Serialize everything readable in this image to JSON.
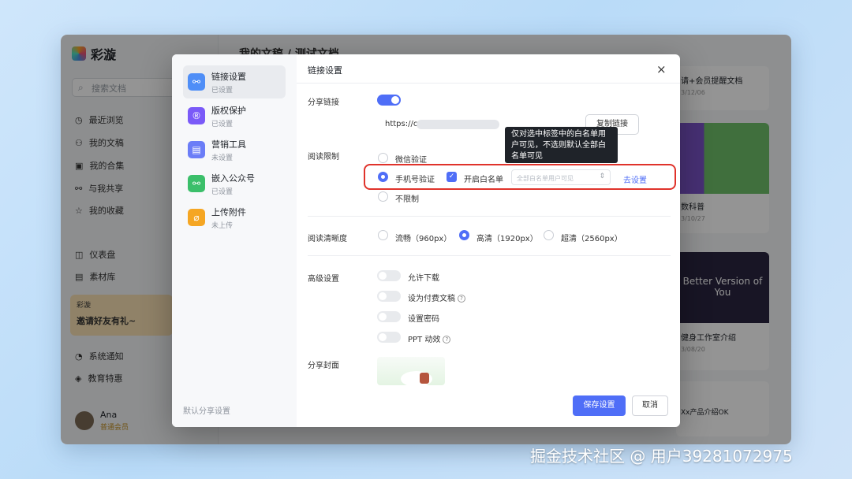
{
  "app": {
    "brand": "彩漩",
    "search_placeholder": "搜索文档",
    "nav": [
      {
        "icon": "clock-icon",
        "glyph": "◷",
        "label": "最近浏览"
      },
      {
        "icon": "user-icon",
        "glyph": "⚇",
        "label": "我的文稿"
      },
      {
        "icon": "collection-icon",
        "glyph": "▣",
        "label": "我的合集"
      },
      {
        "icon": "share-icon",
        "glyph": "⚯",
        "label": "与我共享"
      },
      {
        "icon": "star-icon",
        "glyph": "☆",
        "label": "我的收藏"
      },
      {
        "icon": "dashboard-icon",
        "glyph": "◫",
        "label": "仪表盘"
      },
      {
        "icon": "library-icon",
        "glyph": "▤",
        "label": "素材库"
      },
      {
        "icon": "bell-icon",
        "glyph": "◔",
        "label": "系统通知"
      },
      {
        "icon": "education-icon",
        "glyph": "◈",
        "label": "教育特惠"
      }
    ],
    "promo": {
      "brand": "彩漩",
      "text": "邀请好友有礼~"
    },
    "user": {
      "name": "Ana",
      "badge": "普通会员"
    },
    "breadcrumb": "我的文稿 / 测试文档",
    "cards": [
      {
        "title": "请+会员提醒文档",
        "date": "3/12/06"
      },
      {
        "title": "数科普",
        "date": "3/10/27"
      },
      {
        "title": "健身工作室介绍",
        "date": "3/08/20"
      },
      {
        "title": "Xx产品介绍OK"
      }
    ],
    "card_image_text": "Better Version of You"
  },
  "modal": {
    "header": "链接设置",
    "close_glyph": "×",
    "side_items": [
      {
        "icon": "link-share-icon",
        "glyph": "⚯",
        "color": "#4f8ef7",
        "title": "链接设置",
        "status": "已设置",
        "active": true
      },
      {
        "icon": "copyright-icon",
        "glyph": "®",
        "color": "#7a5af8",
        "title": "版权保护",
        "status": "已设置",
        "active": false
      },
      {
        "icon": "marketing-tool-icon",
        "glyph": "▤",
        "color": "#6b7df7",
        "title": "营销工具",
        "status": "未设置",
        "active": false
      },
      {
        "icon": "wechat-official-icon",
        "glyph": "⚯",
        "color": "#3bbf6a",
        "title": "嵌入公众号",
        "status": "已设置",
        "active": false
      },
      {
        "icon": "attachment-icon",
        "glyph": "⌀",
        "color": "#f5a623",
        "title": "上传附件",
        "status": "未上传",
        "active": false
      }
    ],
    "footer_text": "默认分享设置",
    "share_link": {
      "label": "分享链接",
      "enabled": true,
      "url": "https://c",
      "copy_button": "复制链接",
      "qr_glyph": "▦"
    },
    "tooltip": "仅对选中标签中的白名单用户可见，不选则默认全部白名单可见",
    "read_limit": {
      "label": "阅读限制",
      "options": [
        "微信验证",
        "手机号验证",
        "不限制"
      ],
      "selected": "手机号验证",
      "whitelist_label": "开启白名单",
      "whitelist_checked": true,
      "select_placeholder": "全部白名单用户可见",
      "setup_link": "去设置"
    },
    "clarity": {
      "label": "阅读清晰度",
      "options": [
        "流畅（960px）",
        "高清（1920px）",
        "超清（2560px）"
      ],
      "selected": "高清（1920px）"
    },
    "advanced": {
      "label": "高级设置",
      "items": [
        {
          "label": "允许下载",
          "on": false
        },
        {
          "label": "设为付费文稿",
          "on": false,
          "help": "?"
        },
        {
          "label": "设置密码",
          "on": false
        },
        {
          "label": "PPT 动效",
          "on": false,
          "help": "?"
        }
      ]
    },
    "cover": {
      "label": "分享封面"
    },
    "save_button": "保存设置",
    "cancel_button": "取消"
  },
  "watermark": "掘金技术社区 @ 用户39281072975"
}
